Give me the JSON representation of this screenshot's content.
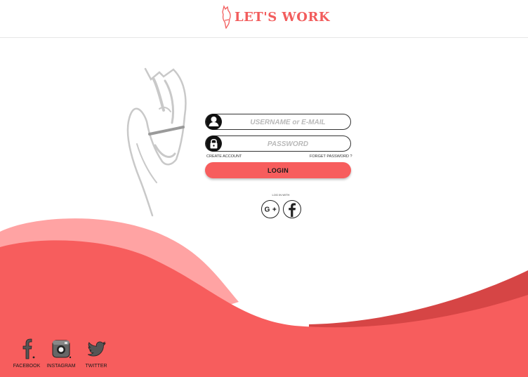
{
  "header": {
    "brand": "LET'S WORK",
    "logo_icon": "horse-head-icon"
  },
  "login_form": {
    "username_placeholder": "USERNAME or E-MAIL",
    "password_placeholder": "PASSWORD",
    "create_account": "CREATE ACCOUNT",
    "forgot_password": "FORGET PASSWORD ?",
    "login_button": "LOGIN",
    "login_with": "LOG IN WITH"
  },
  "footer_social": {
    "facebook": "FACEBOOK",
    "instagram": "INSTAGRAM",
    "twitter": "TWITTER"
  },
  "colors": {
    "accent": "#f75d5d",
    "accent_light": "#ffa3a3",
    "accent_dark": "#d64545",
    "text_dark": "#1a1a1a"
  }
}
